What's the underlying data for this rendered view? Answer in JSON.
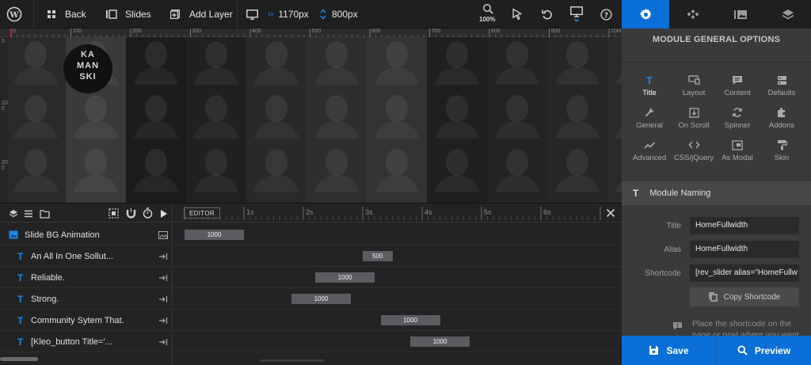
{
  "toolbar": {
    "back_label": "Back",
    "slides_label": "Slides",
    "add_layer_label": "Add Layer",
    "width_value": "1170px",
    "height_value": "800px",
    "zoom_label": "100%"
  },
  "ruler": {
    "top_ticks": [
      "0",
      "100",
      "200",
      "300",
      "400",
      "500",
      "600",
      "700",
      "800",
      "900",
      "1000"
    ],
    "left_ticks": [
      "0",
      "100",
      "200"
    ]
  },
  "canvas": {
    "logo_lines": [
      "KA",
      "MAN",
      "SKI"
    ]
  },
  "timeline": {
    "editor_label": "EDITOR",
    "time_ticks": [
      "1s",
      "2s",
      "3s",
      "4s",
      "5s",
      "6s"
    ],
    "rows": [
      {
        "name": "Slide BG Animation",
        "bar_value": "1000",
        "start_s": 0.0
      },
      {
        "name": "An All In One Sollut...",
        "bar_value": "500",
        "start_s": 3.0
      },
      {
        "name": "Reliable.",
        "bar_value": "1000",
        "start_s": 2.2
      },
      {
        "name": "Strong.",
        "bar_value": "1000",
        "start_s": 1.8
      },
      {
        "name": "Community Sytem That.",
        "bar_value": "1000",
        "start_s": 3.3
      },
      {
        "name": "[Kleo_button Title='...",
        "bar_value": "1000",
        "start_s": 3.8
      }
    ]
  },
  "panel": {
    "title": "MODULE GENERAL OPTIONS",
    "options": [
      {
        "label": "Title",
        "icon": "title-icon"
      },
      {
        "label": "Layout",
        "icon": "layout-icon"
      },
      {
        "label": "Content",
        "icon": "content-icon"
      },
      {
        "label": "Defaults",
        "icon": "defaults-icon"
      },
      {
        "label": "General",
        "icon": "wrench-icon"
      },
      {
        "label": "On Scroll",
        "icon": "scroll-icon"
      },
      {
        "label": "Spinner",
        "icon": "spinner-icon"
      },
      {
        "label": "Addons",
        "icon": "puzzle-icon"
      },
      {
        "label": "Advanced",
        "icon": "chart-line-icon"
      },
      {
        "label": "CSS/jQuery",
        "icon": "code-icon"
      },
      {
        "label": "As Modal",
        "icon": "modal-icon"
      },
      {
        "label": "Skin",
        "icon": "paint-roller-icon"
      }
    ],
    "naming_title": "Module Naming",
    "fields": {
      "title_label": "Title",
      "title_value": "HomeFullwidth",
      "alias_label": "Alias",
      "alias_value": "HomeFullwidth",
      "shortcode_label": "Shortcode",
      "shortcode_value": "[rev_slider alias=\"HomeFullw"
    },
    "copy_label": "Copy Shortcode",
    "hint_text": "Place the shortcode on the page or post where you want",
    "save_label": "Save",
    "preview_label": "Preview"
  },
  "colors": {
    "accent": "#0a6fd6",
    "layer_icon": "#1e88e5"
  }
}
